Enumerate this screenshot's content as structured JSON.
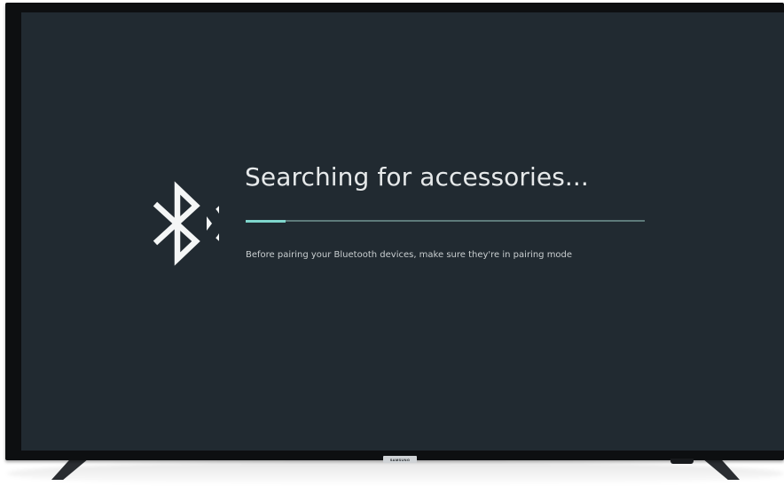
{
  "screen": {
    "title": "Searching for accessories...",
    "subtitle": "Before pairing your Bluetooth devices, make sure they're in pairing mode",
    "progress": 0.1,
    "icon": "bluetooth-searching-icon",
    "colors": {
      "background": "#212a31",
      "accent": "#7fd6cc",
      "track": "#5e7a7a",
      "text": "#e6e9ea"
    }
  },
  "tv": {
    "brand": "SAMSUNG"
  }
}
